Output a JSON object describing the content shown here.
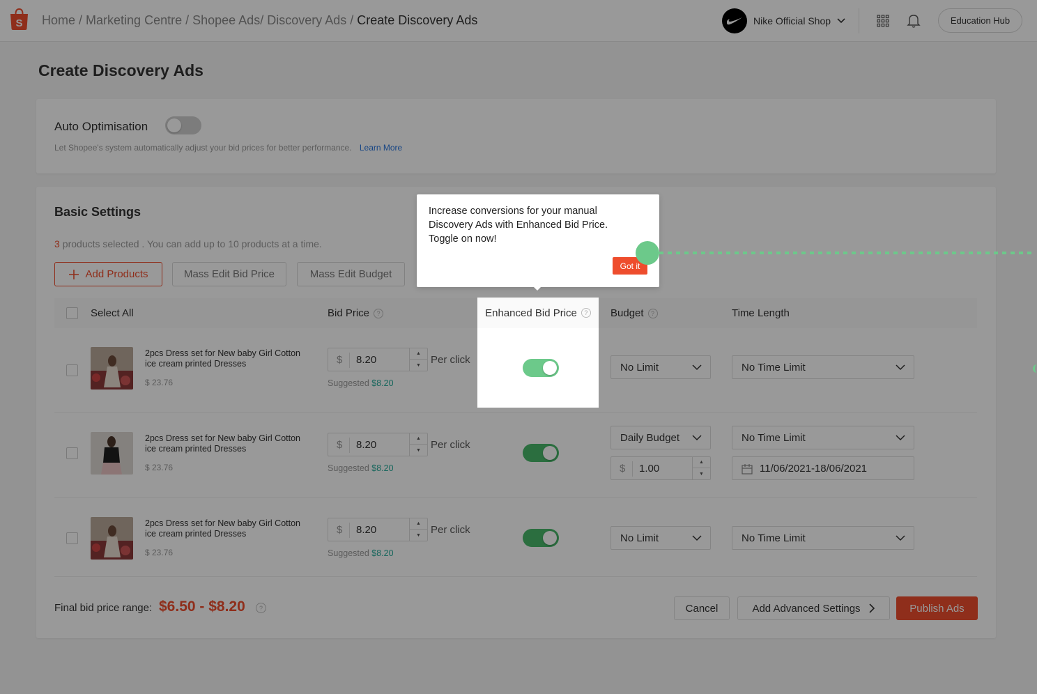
{
  "topbar": {
    "breadcrumb": [
      "Home",
      "Marketing Centre",
      "Shopee Ads",
      "Discovery Ads"
    ],
    "breadcrumb_current": "Create Discovery Ads",
    "shop_name": "Nike Official Shop",
    "education_hub": "Education Hub"
  },
  "page_title": "Create Discovery Ads",
  "auto_optimisation": {
    "label": "Auto Optimisation",
    "enabled": false,
    "description": "Let Shopee's system automatically adjust your bid prices for better performance.",
    "learn_more": "Learn More"
  },
  "basic_settings": {
    "title": "Basic Settings",
    "selected_count": "3",
    "selected_text": "products selected . You can add up to 10 products at a time.",
    "add_products": "Add Products",
    "mass_edit_bid": "Mass Edit Bid Price",
    "mass_edit_budget": "Mass Edit Budget",
    "columns": {
      "select_all": "Select All",
      "bid_price": "Bid Price",
      "enhanced_bid_price": "Enhanced Bid Price",
      "budget": "Budget",
      "time_length": "Time Length"
    },
    "rows": [
      {
        "name": "2pcs Dress set for New baby Girl Cotton ice cream printed Dresses",
        "price": "$ 23.76",
        "currency": "$",
        "bid": "8.20",
        "per_click": "Per click",
        "suggested_label": "Suggested",
        "suggested": "$8.20",
        "enhanced": true,
        "budget": "No Limit",
        "time": "No Time Limit"
      },
      {
        "name": "2pcs Dress set for New baby Girl Cotton ice cream printed Dresses",
        "price": "$ 23.76",
        "currency": "$",
        "bid": "8.20",
        "per_click": "Per click",
        "suggested_label": "Suggested",
        "suggested": "$8.20",
        "enhanced": true,
        "budget": "Daily Budget",
        "budget_amount": "1.00",
        "time": "No Time Limit",
        "date_range": "11/06/2021-18/06/2021"
      },
      {
        "name": "2pcs Dress set for New baby Girl Cotton ice cream printed Dresses",
        "price": "$ 23.76",
        "currency": "$",
        "bid": "8.20",
        "per_click": "Per click",
        "suggested_label": "Suggested",
        "suggested": "$8.20",
        "enhanced": true,
        "budget": "No Limit",
        "time": "No Time Limit"
      }
    ],
    "final_bid_label": "Final bid price range:",
    "final_bid_range": "$6.50 - $8.20",
    "cancel": "Cancel",
    "add_advanced": "Add Advanced Settings",
    "publish": "Publish Ads"
  },
  "tooltip": {
    "message": "Increase conversions for your manual Discovery Ads with Enhanced Bid Price. Toggle on now!",
    "got_it": "Got it"
  },
  "colors": {
    "brand": "#ee4d2d",
    "toggle_on": "#48b86a",
    "spotlight_green": "#6cc98a",
    "link": "#2673dd"
  }
}
